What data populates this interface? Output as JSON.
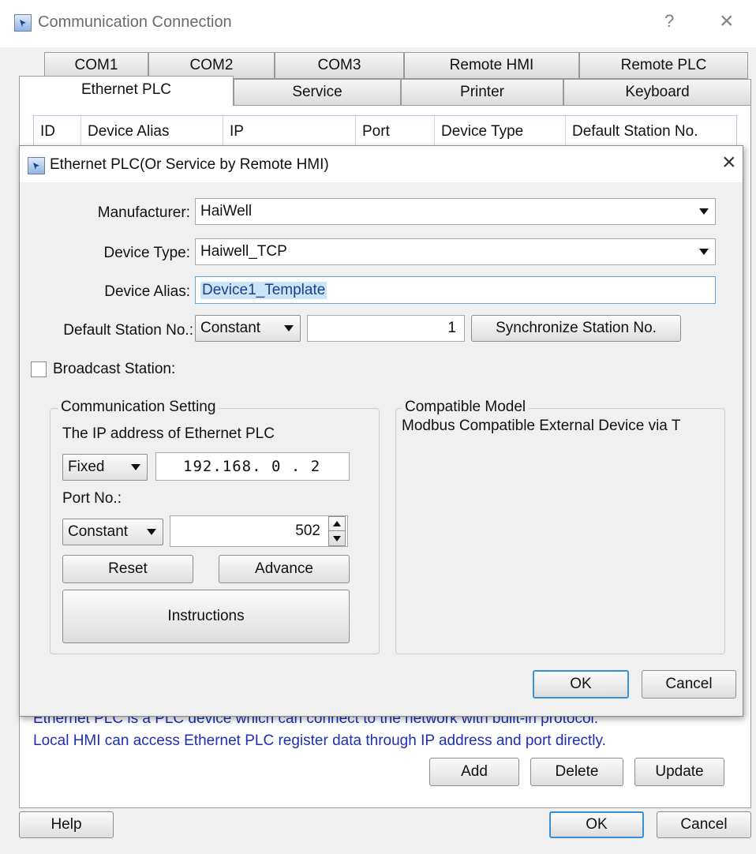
{
  "window": {
    "title": "Communication Connection",
    "help_glyph": "?",
    "close_glyph": "×",
    "icon": "app-window-icon"
  },
  "tabs_row1": [
    "COM1",
    "COM2",
    "COM3",
    "Remote HMI",
    "Remote PLC"
  ],
  "tabs_row2": [
    "Ethernet PLC",
    "Service",
    "Printer",
    "Keyboard"
  ],
  "active_tab": "Ethernet PLC",
  "grid": {
    "columns": [
      "ID",
      "Device Alias",
      "IP",
      "Port",
      "Device Type",
      "Default Station No."
    ]
  },
  "description": {
    "line1": "Ethernet PLC is a PLC device which can connect to the network with built-in protocol.",
    "line2": "Local HMI can access Ethernet PLC register data through IP address and port directly."
  },
  "list_buttons": {
    "add": "Add",
    "delete": "Delete",
    "update": "Update"
  },
  "footer": {
    "help": "Help",
    "ok": "OK",
    "cancel": "Cancel"
  },
  "dialog": {
    "title": "Ethernet PLC(Or Service by Remote HMI)",
    "close_glyph": "×",
    "manufacturer": {
      "label": "Manufacturer:",
      "value": "HaiWell"
    },
    "device_type": {
      "label": "Device Type:",
      "value": "Haiwell_TCP"
    },
    "device_alias": {
      "label": "Device Alias:",
      "value": "Device1_Template"
    },
    "station": {
      "label": "Default Station No.:",
      "mode": "Constant",
      "value": "1",
      "sync_button": "Synchronize Station No."
    },
    "broadcast": {
      "label": "Broadcast Station:",
      "checked": false
    },
    "comm": {
      "title": "Communication Setting",
      "ip_label": "The IP address of Ethernet PLC",
      "ip_mode": "Fixed",
      "ip_value": "192.168. 0 . 2",
      "port_label": "Port No.:",
      "port_mode": "Constant",
      "port_value": "502",
      "reset": "Reset",
      "advance": "Advance",
      "instructions": "Instructions"
    },
    "compatible": {
      "title": "Compatible Model",
      "text": "Modbus Compatible External Device via T"
    },
    "ok": "OK",
    "cancel": "Cancel"
  }
}
